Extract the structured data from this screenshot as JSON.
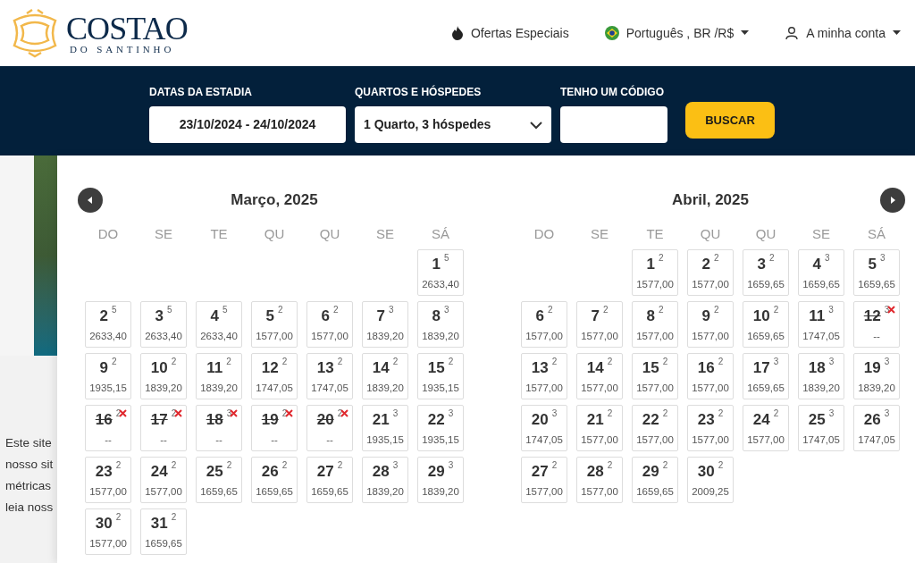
{
  "header": {
    "logo": {
      "name": "COSTAO",
      "tagline": "DO SANTINHO"
    },
    "nav": [
      {
        "kind": "offers",
        "label": "Ofertas Especiais"
      },
      {
        "kind": "language",
        "label": "Português , BR /R$"
      },
      {
        "kind": "account",
        "label": "A minha conta"
      }
    ]
  },
  "search_bar": {
    "dates": {
      "label": "DATAS DA ESTADIA",
      "value": "23/10/2024 - 24/10/2024"
    },
    "rooms": {
      "label": "QUARTOS E HÓSPEDES",
      "value": "1 Quarto, 3 hóspedes"
    },
    "code": {
      "label": "TENHO UM CÓDIGO"
    },
    "button": "BUSCAR"
  },
  "cookie_notice": {
    "lines": [
      "Este site",
      "nosso sit",
      "métricas",
      "leia noss"
    ]
  },
  "calendar": {
    "months": [
      {
        "title": "Março, 2025",
        "weekdays": [
          "DO",
          "SE",
          "TE",
          "QU",
          "QU",
          "SE",
          "SÁ"
        ],
        "days": [
          {
            "kind": "empty"
          },
          {
            "kind": "empty"
          },
          {
            "kind": "empty"
          },
          {
            "kind": "empty"
          },
          {
            "kind": "empty"
          },
          {
            "kind": "empty"
          },
          {
            "day": "1",
            "min": "5",
            "price": "2633,40",
            "available": true
          },
          {
            "day": "2",
            "min": "5",
            "price": "2633,40",
            "available": true
          },
          {
            "day": "3",
            "min": "5",
            "price": "2633,40",
            "available": true
          },
          {
            "day": "4",
            "min": "5",
            "price": "2633,40",
            "available": true
          },
          {
            "day": "5",
            "min": "2",
            "price": "1577,00",
            "available": true
          },
          {
            "day": "6",
            "min": "2",
            "price": "1577,00",
            "available": true
          },
          {
            "day": "7",
            "min": "3",
            "price": "1839,20",
            "available": true
          },
          {
            "day": "8",
            "min": "3",
            "price": "1839,20",
            "available": true
          },
          {
            "day": "9",
            "min": "2",
            "price": "1935,15",
            "available": true
          },
          {
            "day": "10",
            "min": "2",
            "price": "1839,20",
            "available": true
          },
          {
            "day": "11",
            "min": "2",
            "price": "1839,20",
            "available": true
          },
          {
            "day": "12",
            "min": "2",
            "price": "1747,05",
            "available": true
          },
          {
            "day": "13",
            "min": "2",
            "price": "1747,05",
            "available": true
          },
          {
            "day": "14",
            "min": "2",
            "price": "1839,20",
            "available": true
          },
          {
            "day": "15",
            "min": "2",
            "price": "1935,15",
            "available": true
          },
          {
            "day": "16",
            "min": "2",
            "price": "--",
            "available": false
          },
          {
            "day": "17",
            "min": "2",
            "price": "--",
            "available": false
          },
          {
            "day": "18",
            "min": "3",
            "price": "--",
            "available": false
          },
          {
            "day": "19",
            "min": "2",
            "price": "--",
            "available": false
          },
          {
            "day": "20",
            "min": "2",
            "price": "--",
            "available": false
          },
          {
            "day": "21",
            "min": "3",
            "price": "1935,15",
            "available": true
          },
          {
            "day": "22",
            "min": "3",
            "price": "1935,15",
            "available": true
          },
          {
            "day": "23",
            "min": "2",
            "price": "1577,00",
            "available": true
          },
          {
            "day": "24",
            "min": "2",
            "price": "1577,00",
            "available": true
          },
          {
            "day": "25",
            "min": "2",
            "price": "1659,65",
            "available": true
          },
          {
            "day": "26",
            "min": "2",
            "price": "1659,65",
            "available": true
          },
          {
            "day": "27",
            "min": "2",
            "price": "1659,65",
            "available": true
          },
          {
            "day": "28",
            "min": "3",
            "price": "1839,20",
            "available": true
          },
          {
            "day": "29",
            "min": "3",
            "price": "1839,20",
            "available": true
          },
          {
            "day": "30",
            "min": "2",
            "price": "1577,00",
            "available": true
          },
          {
            "day": "31",
            "min": "2",
            "price": "1659,65",
            "available": true
          }
        ]
      },
      {
        "title": "Abril, 2025",
        "weekdays": [
          "DO",
          "SE",
          "TE",
          "QU",
          "QU",
          "SE",
          "SÁ"
        ],
        "days": [
          {
            "kind": "empty"
          },
          {
            "kind": "empty"
          },
          {
            "day": "1",
            "min": "2",
            "price": "1577,00",
            "available": true
          },
          {
            "day": "2",
            "min": "2",
            "price": "1577,00",
            "available": true
          },
          {
            "day": "3",
            "min": "2",
            "price": "1659,65",
            "available": true
          },
          {
            "day": "4",
            "min": "3",
            "price": "1659,65",
            "available": true
          },
          {
            "day": "5",
            "min": "3",
            "price": "1659,65",
            "available": true
          },
          {
            "day": "6",
            "min": "2",
            "price": "1577,00",
            "available": true
          },
          {
            "day": "7",
            "min": "2",
            "price": "1577,00",
            "available": true
          },
          {
            "day": "8",
            "min": "2",
            "price": "1577,00",
            "available": true
          },
          {
            "day": "9",
            "min": "2",
            "price": "1577,00",
            "available": true
          },
          {
            "day": "10",
            "min": "2",
            "price": "1659,65",
            "available": true
          },
          {
            "day": "11",
            "min": "3",
            "price": "1747,05",
            "available": true
          },
          {
            "day": "12",
            "min": "3",
            "price": "--",
            "available": false
          },
          {
            "day": "13",
            "min": "2",
            "price": "1577,00",
            "available": true
          },
          {
            "day": "14",
            "min": "2",
            "price": "1577,00",
            "available": true
          },
          {
            "day": "15",
            "min": "2",
            "price": "1577,00",
            "available": true
          },
          {
            "day": "16",
            "min": "2",
            "price": "1577,00",
            "available": true
          },
          {
            "day": "17",
            "min": "3",
            "price": "1659,65",
            "available": true
          },
          {
            "day": "18",
            "min": "3",
            "price": "1839,20",
            "available": true
          },
          {
            "day": "19",
            "min": "3",
            "price": "1839,20",
            "available": true
          },
          {
            "day": "20",
            "min": "3",
            "price": "1747,05",
            "available": true
          },
          {
            "day": "21",
            "min": "2",
            "price": "1577,00",
            "available": true
          },
          {
            "day": "22",
            "min": "2",
            "price": "1577,00",
            "available": true
          },
          {
            "day": "23",
            "min": "2",
            "price": "1577,00",
            "available": true
          },
          {
            "day": "24",
            "min": "2",
            "price": "1577,00",
            "available": true
          },
          {
            "day": "25",
            "min": "3",
            "price": "1747,05",
            "available": true
          },
          {
            "day": "26",
            "min": "3",
            "price": "1747,05",
            "available": true
          },
          {
            "day": "27",
            "min": "2",
            "price": "1577,00",
            "available": true
          },
          {
            "day": "28",
            "min": "2",
            "price": "1577,00",
            "available": true
          },
          {
            "day": "29",
            "min": "2",
            "price": "1659,65",
            "available": true
          },
          {
            "day": "30",
            "min": "2",
            "price": "2009,25",
            "available": true
          }
        ]
      }
    ]
  }
}
